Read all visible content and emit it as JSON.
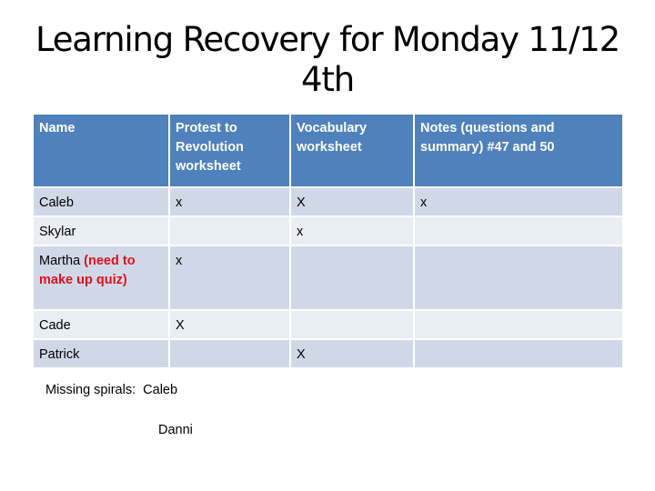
{
  "title": {
    "line1": "Learning Recovery for Monday 11/12",
    "line2": "4th"
  },
  "table": {
    "headers": [
      "Name",
      "Protest to Revolution worksheet",
      "Vocabulary worksheet",
      "Notes (questions and summary) #47 and 50"
    ],
    "rows": [
      {
        "name": "Caleb",
        "note": "",
        "protest": "x",
        "vocab": "X",
        "notes": "x"
      },
      {
        "name": "Skylar",
        "note": "",
        "protest": "",
        "vocab": "x",
        "notes": ""
      },
      {
        "name": "Martha",
        "note": "(need to make up quiz)",
        "protest": "x",
        "vocab": "",
        "notes": ""
      },
      {
        "name": "Cade",
        "note": "",
        "protest": "X",
        "vocab": "",
        "notes": ""
      },
      {
        "name": "Patrick",
        "note": "",
        "protest": "",
        "vocab": "X",
        "notes": ""
      }
    ]
  },
  "footer": {
    "missing_spirals_line": "Missing spirals:  Caleb",
    "missing_spirals_line2": "Danni"
  },
  "colors": {
    "header_bg": "#4f81bd",
    "row_odd_bg": "#d0d8e8",
    "row_even_bg": "#e9edf4",
    "note_red": "#e0101a"
  }
}
